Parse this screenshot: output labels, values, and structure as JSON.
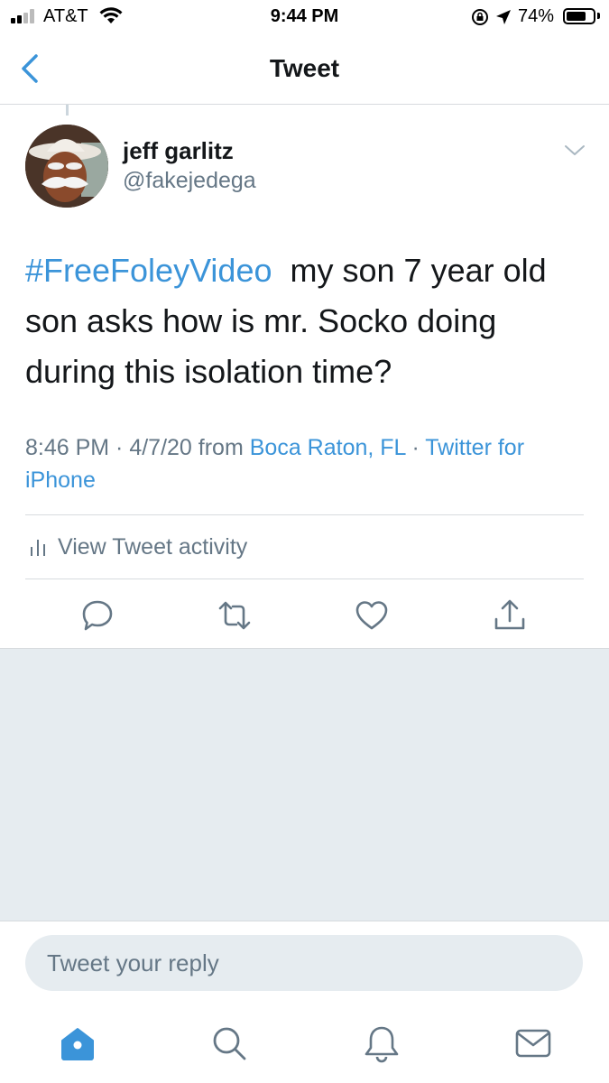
{
  "status_bar": {
    "carrier": "AT&T",
    "time": "9:44 PM",
    "battery_percent": "74%",
    "battery_level": 0.74
  },
  "nav": {
    "title": "Tweet"
  },
  "tweet": {
    "author_name": "jeff garlitz",
    "author_handle": "@fakejedega",
    "hashtag": "#FreeFoleyVideo",
    "body": "  my son 7 year old son asks how is mr. Socko doing during this isolation time?",
    "time": "8:46 PM · 4/7/20",
    "from_word": " from ",
    "location": "Boca Raton, FL",
    "separator": " · ",
    "source": "Twitter for iPhone"
  },
  "activity": {
    "label": "View Tweet activity"
  },
  "reply": {
    "placeholder": "Tweet your reply"
  },
  "colors": {
    "accent": "#3b94d9",
    "secondary_text": "#657786",
    "divider": "#d7dbde",
    "grey_background": "#e6ecf0"
  },
  "icons": {
    "back": "chevron-left-icon",
    "caret": "chevron-down-icon",
    "reply": "comment-icon",
    "retweet": "retweet-icon",
    "like": "heart-icon",
    "share": "share-icon",
    "activity": "bar-chart-icon",
    "tab_home": "home-icon",
    "tab_search": "search-icon",
    "tab_notifications": "bell-icon",
    "tab_messages": "envelope-icon"
  }
}
